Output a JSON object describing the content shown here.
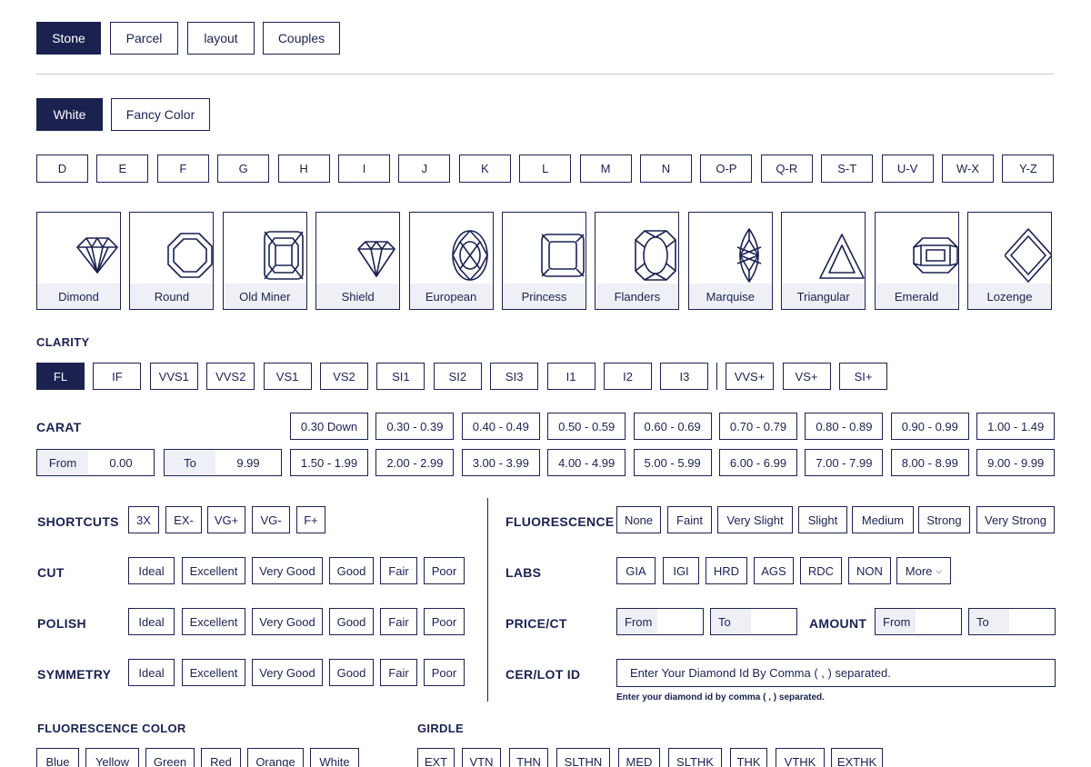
{
  "type_tabs": [
    "Stone",
    "Parcel",
    "layout",
    "Couples"
  ],
  "color_tabs": [
    "White",
    "Fancy Color"
  ],
  "colors": [
    "D",
    "E",
    "F",
    "G",
    "H",
    "I",
    "J",
    "K",
    "L",
    "M",
    "N",
    "O-P",
    "Q-R",
    "S-T",
    "U-V",
    "W-X",
    "Y-Z"
  ],
  "shapes": [
    {
      "name": "Dimond",
      "icon": "brilliant-diamond-icon"
    },
    {
      "name": "Round",
      "icon": "round-cut-icon"
    },
    {
      "name": "Old Miner",
      "icon": "old-miner-cut-icon"
    },
    {
      "name": "Shield",
      "icon": "shield-cut-icon"
    },
    {
      "name": "European",
      "icon": "european-cut-icon"
    },
    {
      "name": "Princess",
      "icon": "princess-cut-icon"
    },
    {
      "name": "Flanders",
      "icon": "flanders-cut-icon"
    },
    {
      "name": "Marquise",
      "icon": "marquise-cut-icon"
    },
    {
      "name": "Triangular",
      "icon": "triangular-cut-icon"
    },
    {
      "name": "Emerald",
      "icon": "emerald-cut-icon"
    },
    {
      "name": "Lozenge",
      "icon": "lozenge-cut-icon"
    }
  ],
  "clarity": {
    "label": "CLARITY",
    "options": [
      "FL",
      "IF",
      "VVS1",
      "VVS2",
      "VS1",
      "VS2",
      "SI1",
      "SI2",
      "SI3",
      "I1",
      "I2",
      "I3"
    ],
    "extra": [
      "VVS+",
      "VS+",
      "SI+"
    ],
    "selected": "FL"
  },
  "carat": {
    "label": "CARAT",
    "from_label": "From",
    "from_value": "0.00",
    "to_label": "To",
    "to_value": "9.99",
    "ranges_row1": [
      "0.30 Down",
      "0.30 - 0.39",
      "0.40 - 0.49",
      "0.50 - 0.59",
      "0.60 - 0.69",
      "0.70 - 0.79",
      "0.80 - 0.89",
      "0.90 - 0.99",
      "1.00 - 1.49"
    ],
    "ranges_row2": [
      "1.50 - 1.99",
      "2.00 - 2.99",
      "3.00 - 3.99",
      "4.00 - 4.99",
      "5.00 - 5.99",
      "6.00 - 6.99",
      "7.00 - 7.99",
      "8.00 - 8.99",
      "9.00 - 9.99"
    ]
  },
  "shortcuts": {
    "label": "SHORTCUTS",
    "options": [
      "3X",
      "EX-",
      "VG+",
      "VG-",
      "F+"
    ]
  },
  "cut": {
    "label": "CUT",
    "options": [
      "Ideal",
      "Excellent",
      "Very Good",
      "Good",
      "Fair",
      "Poor"
    ]
  },
  "polish": {
    "label": "POLISH",
    "options": [
      "Ideal",
      "Excellent",
      "Very Good",
      "Good",
      "Fair",
      "Poor"
    ]
  },
  "symmetry": {
    "label": "SYMMETRY",
    "options": [
      "Ideal",
      "Excellent",
      "Very Good",
      "Good",
      "Fair",
      "Poor"
    ]
  },
  "fluorescence": {
    "label": "FLUORESCENCE",
    "options": [
      "None",
      "Faint",
      "Very Slight",
      "Slight",
      "Medium",
      "Strong",
      "Very Strong"
    ]
  },
  "labs": {
    "label": "LABS",
    "options": [
      "GIA",
      "IGI",
      "HRD",
      "AGS",
      "RDC",
      "NON"
    ],
    "more_label": "More"
  },
  "price": {
    "label": "PRICE/CT",
    "from_label": "From",
    "to_label": "To"
  },
  "amount": {
    "label": "AMOUNT",
    "from_label": "From",
    "to_label": "To"
  },
  "cer": {
    "label": "CER/LOT ID",
    "placeholder": "Enter Your Diamond Id By Comma ( , ) separated.",
    "note": "Enter your diamond id by comma ( , ) separated."
  },
  "fluor_color": {
    "label": "FLUORESCENCE COLOR",
    "options": [
      "Blue",
      "Yellow",
      "Green",
      "Red",
      "Orange",
      "White"
    ]
  },
  "girdle": {
    "label": "GIRDLE",
    "options": [
      "EXT",
      "VTN",
      "THN",
      "SLTHN",
      "MED",
      "SLTHK",
      "THK",
      "VTHK",
      "EXTHK"
    ]
  },
  "colors_theme": {
    "primary": "#1b2250",
    "muted": "#eef0f5",
    "divider": "#c9cbd6"
  }
}
